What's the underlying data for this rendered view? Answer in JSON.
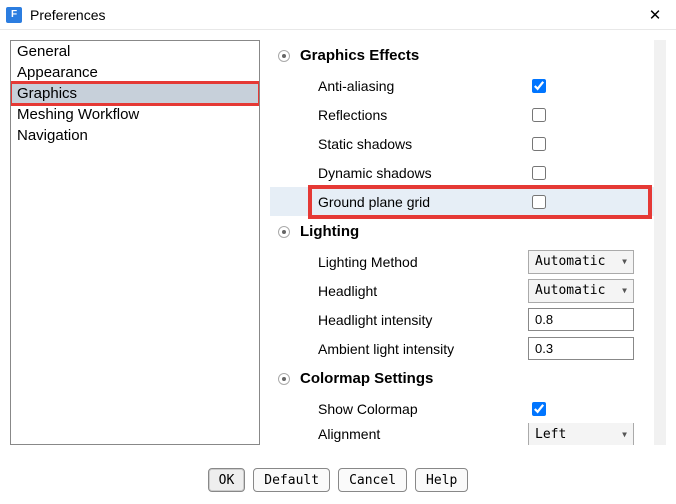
{
  "window": {
    "title": "Preferences",
    "icon_letter": "F"
  },
  "sidebar": {
    "items": [
      {
        "label": "General"
      },
      {
        "label": "Appearance"
      },
      {
        "label": "Graphics"
      },
      {
        "label": "Meshing Workflow"
      },
      {
        "label": "Navigation"
      }
    ]
  },
  "sections": {
    "graphics_effects": {
      "title": "Graphics Effects",
      "anti_aliasing": {
        "label": "Anti-aliasing",
        "checked": true
      },
      "reflections": {
        "label": "Reflections",
        "checked": false
      },
      "static_shadows": {
        "label": "Static shadows",
        "checked": false
      },
      "dynamic_shadows": {
        "label": "Dynamic shadows",
        "checked": false
      },
      "ground_plane_grid": {
        "label": "Ground plane grid",
        "checked": false
      }
    },
    "lighting": {
      "title": "Lighting",
      "lighting_method": {
        "label": "Lighting Method",
        "value": "Automatic"
      },
      "headlight": {
        "label": "Headlight",
        "value": "Automatic"
      },
      "headlight_intensity": {
        "label": "Headlight intensity",
        "value": "0.8"
      },
      "ambient_light_intensity": {
        "label": "Ambient light intensity",
        "value": "0.3"
      }
    },
    "colormap": {
      "title": "Colormap Settings",
      "show_colormap": {
        "label": "Show Colormap",
        "checked": true
      },
      "alignment": {
        "label": "Alignment",
        "value": "Left"
      }
    }
  },
  "footer": {
    "ok": "OK",
    "default": "Default",
    "cancel": "Cancel",
    "help": "Help"
  }
}
